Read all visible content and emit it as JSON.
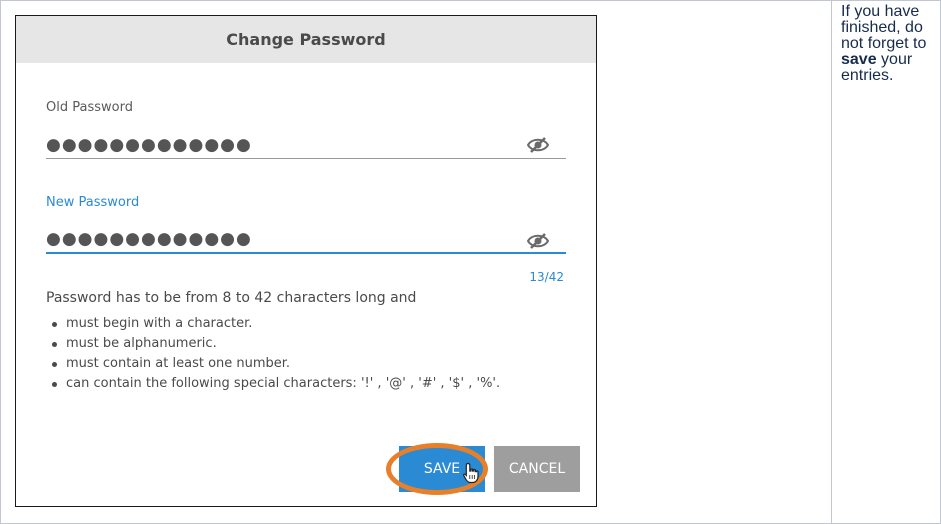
{
  "dialog": {
    "title": "Change Password",
    "old_password": {
      "label": "Old Password",
      "value": "●●●●●●●●●●●●●"
    },
    "new_password": {
      "label": "New Password",
      "value": "●●●●●●●●●●●●●",
      "counter": "13/42"
    },
    "rules_intro": "Password has to be from 8 to 42 characters long and",
    "rules": [
      "must begin with a character.",
      "must be alphanumeric.",
      "must contain at least one number.",
      "can contain the following special characters: '!' , '@' , '#' , '$' , '%'."
    ],
    "save_label": "SAVE",
    "cancel_label": "CANCEL"
  },
  "note": {
    "before": "If you have finished, do not forget to",
    "bold": "save",
    "after": "your entries."
  },
  "icons": {
    "visibility_toggle": "eye-slash-icon",
    "cursor": "hand-pointer-icon"
  },
  "colors": {
    "accent": "#2a8ad4",
    "cancel": "#9e9e9e",
    "highlight": "#e8802a",
    "header_bg": "#e6e6e6"
  }
}
